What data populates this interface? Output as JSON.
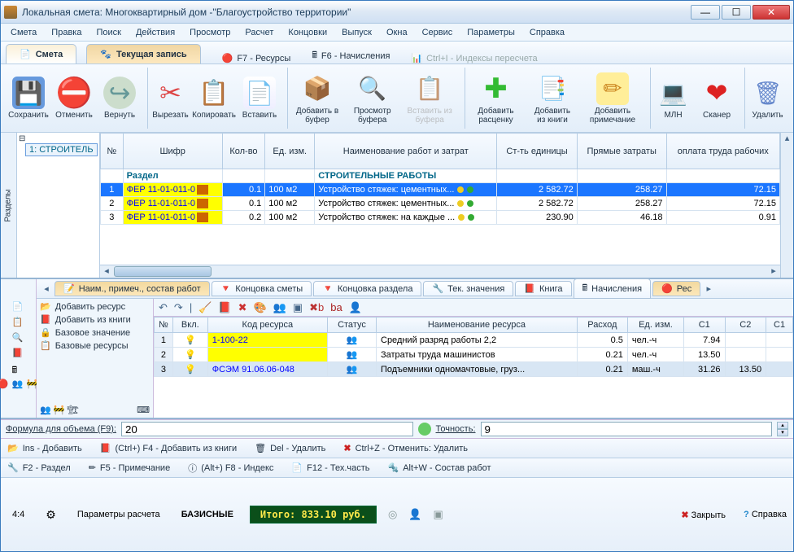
{
  "title": "Локальная смета: Многоквартирный дом -\"Благоустройство территории\"",
  "menu": [
    "Смета",
    "Правка",
    "Поиск",
    "Действия",
    "Просмотр",
    "Расчет",
    "Концовки",
    "Выпуск",
    "Окна",
    "Сервис",
    "Параметры",
    "Справка"
  ],
  "tabs": {
    "smeta": "Смета",
    "current": "Текущая запись",
    "f7": "F7 - Ресурсы",
    "f6": "F6 - Начисления",
    "ctrli": "Ctrl+I - Индексы пересчета"
  },
  "toolbar": [
    {
      "name": "save",
      "label": "Сохранить",
      "icon": "ic-save"
    },
    {
      "name": "undo",
      "label": "Отменить",
      "icon": "ic-undo"
    },
    {
      "name": "redo",
      "label": "Вернуть",
      "icon": "ic-redo"
    },
    {
      "name": "cut",
      "label": "Вырезать",
      "icon": "ic-cut",
      "sep": true
    },
    {
      "name": "copy",
      "label": "Копировать",
      "icon": "ic-copy"
    },
    {
      "name": "paste",
      "label": "Вставить",
      "icon": "ic-paste"
    },
    {
      "name": "addbuf",
      "label": "Добавить в буфер",
      "icon": "ic-addbuf",
      "sep": true
    },
    {
      "name": "preview",
      "label": "Просмотр буфера",
      "icon": "ic-preview"
    },
    {
      "name": "pastebuf",
      "label": "Вставить из буфера",
      "icon": "ic-pastebuf",
      "disabled": true
    },
    {
      "name": "addrate",
      "label": "Добавить расценку",
      "icon": "ic-plus",
      "sep": true
    },
    {
      "name": "addbook",
      "label": "Добавить из книги",
      "icon": "ic-addbook"
    },
    {
      "name": "addnote",
      "label": "Добавить примечание",
      "icon": "ic-note"
    },
    {
      "name": "mln",
      "label": "МЛН",
      "icon": "ic-mln",
      "sep": true
    },
    {
      "name": "scan",
      "label": "Сканер",
      "icon": "ic-scan"
    },
    {
      "name": "del",
      "label": "Удалить",
      "icon": "ic-del",
      "sep": true
    }
  ],
  "sidepane": {
    "label": "Разделы",
    "node": "1: СТРОИТЕЛЬ"
  },
  "grid": {
    "headers": [
      "№",
      "Шифр",
      "Кол-во",
      "Ед. изм.",
      "Наименование работ и затрат",
      "Ст-ть единицы",
      "Прямые затраты",
      "оплата труда рабочих"
    ],
    "section": {
      "label": "Раздел",
      "title": "СТРОИТЕЛЬНЫЕ РАБОТЫ"
    },
    "rows": [
      {
        "n": "1",
        "code": "ФЕР 11-01-011-0",
        "qty": "0.1",
        "unit": "100 м2",
        "name": "Устройство стяжек: цементных...",
        "unitcost": "2 582.72",
        "direct": "258.27",
        "labor": "72.15",
        "hl": true
      },
      {
        "n": "2",
        "code": "ФЕР 11-01-011-0",
        "qty": "0.1",
        "unit": "100 м2",
        "name": "Устройство стяжек: цементных...",
        "unitcost": "2 582.72",
        "direct": "258.27",
        "labor": "72.15"
      },
      {
        "n": "3",
        "code": "ФЕР 11-01-011-0",
        "qty": "0.2",
        "unit": "100 м2",
        "name": "Устройство стяжек: на каждые ...",
        "unitcost": "230.90",
        "direct": "46.18",
        "labor": "0.91"
      }
    ]
  },
  "lowertabs": [
    "Наим., примеч., состав работ",
    "Концовка сметы",
    "Концовка раздела",
    "Тек. значения",
    "Книга",
    "Начисления",
    "Рес"
  ],
  "actions": {
    "addres": "Добавить ресурс",
    "addbook": "Добавить из книги",
    "baseval": "Базовое значение",
    "baseres": "Базовые ресурсы"
  },
  "rgrid": {
    "headers": [
      "№",
      "Вкл.",
      "Код ресурса",
      "Статус",
      "Наименование ресурса",
      "Расход",
      "Ед. изм.",
      "С1",
      "С2",
      "С1"
    ],
    "rows": [
      {
        "n": "1",
        "code": "1-100-22",
        "name": "Средний разряд работы 2,2",
        "qty": "0.5",
        "unit": "чел.-ч",
        "c1": "7.94",
        "c2": ""
      },
      {
        "n": "2",
        "code": "",
        "name": "Затраты труда машинистов",
        "qty": "0.21",
        "unit": "чел.-ч",
        "c1": "13.50",
        "c2": ""
      },
      {
        "n": "3",
        "code": "ФСЭМ 91.06.06-048",
        "name": "Подъемники одномачтовые, груз...",
        "qty": "0.21",
        "unit": "маш.-ч",
        "c1": "31.26",
        "c2": "13.50",
        "hl": true
      }
    ]
  },
  "formula": {
    "label": "Формула для объема (F9):",
    "value": "20",
    "prec_label": "Точность:",
    "prec": "9"
  },
  "actbar1": [
    {
      "label": "Ins - Добавить"
    },
    {
      "label": "(Ctrl+) F4 - Добавить из книги"
    },
    {
      "label": "Del - Удалить"
    },
    {
      "label": "Ctrl+Z - Отменить: Удалить"
    }
  ],
  "actbar2": [
    {
      "label": "F2 - Раздел"
    },
    {
      "label": "F5 - Примечание"
    },
    {
      "label": "(Alt+) F8 - Индекс"
    },
    {
      "label": "F12 - Тех.часть"
    },
    {
      "label": "Alt+W - Состав работ"
    }
  ],
  "status": {
    "pos": "4:4",
    "params": "Параметры расчета",
    "basis": "БАЗИСНЫЕ",
    "total": "Итого: 833.10 руб.",
    "close": "Закрыть",
    "help": "Справка"
  }
}
